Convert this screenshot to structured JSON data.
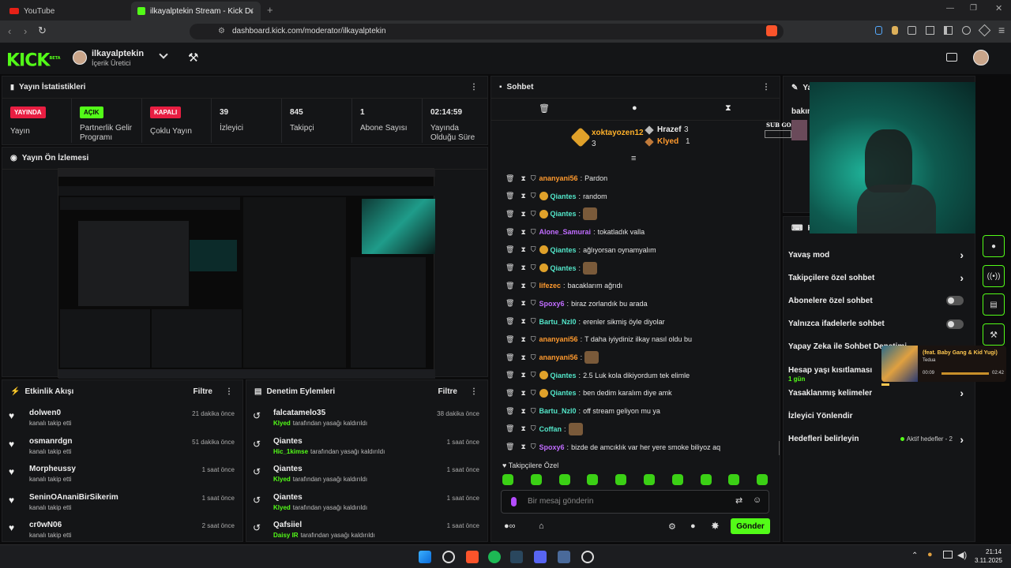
{
  "browser": {
    "tabs": [
      {
        "title": "YouTube"
      },
      {
        "title": "ilkayalptekin Stream - Kick Dashb"
      }
    ],
    "url": "dashboard.kick.com/moderator/ilkayalptekin"
  },
  "header": {
    "logo": "KICK",
    "logo_beta": "BETA",
    "user_name": "ilkayalptekin",
    "user_role": "İçerik Üretici"
  },
  "stats": {
    "title": "Yayın İstatistikleri",
    "items": [
      {
        "badge": "YAYINDA",
        "label": "Yayın"
      },
      {
        "badge": "AÇIK",
        "label": "Partnerlik Gelir Programı"
      },
      {
        "badge": "KAPALI",
        "label": "Çoklu Yayın"
      },
      {
        "value": "39",
        "label": "İzleyici"
      },
      {
        "value": "845",
        "label": "Takipçi"
      },
      {
        "value": "1",
        "label": "Abone Sayısı"
      },
      {
        "value": "02:14:59",
        "label": "Yayında Olduğu Süre"
      }
    ]
  },
  "preview": {
    "title": "Yayın Ön İzlemesi"
  },
  "activity": {
    "title": "Etkinlik Akışı",
    "filter": "Filtre",
    "items": [
      {
        "name": "dolwen0",
        "sub": "kanalı takip etti",
        "time": "21 dakika önce"
      },
      {
        "name": "osmanrdgn",
        "sub": "kanalı takip etti",
        "time": "51 dakika önce"
      },
      {
        "name": "Morpheussy",
        "sub": "kanalı takip etti",
        "time": "1 saat önce"
      },
      {
        "name": "SeninOAnaniBirSikerim",
        "sub": "kanalı takip etti",
        "time": "1 saat önce"
      },
      {
        "name": "cr0wN06",
        "sub": "kanalı takip etti",
        "time": "2 saat önce"
      }
    ]
  },
  "moderation": {
    "title": "Denetim Eylemleri",
    "filter": "Filtre",
    "items": [
      {
        "name": "falcatamelo35",
        "actor": "Klyed",
        "action": "tarafından yasağı kaldırıldı",
        "time": "38 dakika önce"
      },
      {
        "name": "Qiantes",
        "actor": "Hic_1kimse",
        "action": "tarafından yasağı kaldırıldı",
        "time": "1 saat önce"
      },
      {
        "name": "Qiantes",
        "actor": "Klyed",
        "action": "tarafından yasağı kaldırıldı",
        "time": "1 saat önce"
      },
      {
        "name": "Qiantes",
        "actor": "Klyed",
        "action": "tarafından yasağı kaldırıldı",
        "time": "1 saat önce"
      },
      {
        "name": "Qafsiiel",
        "actor": "Daisy IR",
        "action": "tarafından yasağı kaldırıldı",
        "time": "1 saat önce"
      }
    ]
  },
  "chat": {
    "title": "Sohbet",
    "top": [
      {
        "name": "xoktayozen12",
        "count": "3"
      },
      {
        "name": "Hrazef",
        "count": "3"
      },
      {
        "name": "Klyed",
        "count": "1"
      }
    ],
    "messages": [
      {
        "user": "ananyani56",
        "color": "#ff9a2e",
        "badge": false,
        "text": "Pardon"
      },
      {
        "user": "Qiantes",
        "color": "#53e6c9",
        "badge": true,
        "text": "random"
      },
      {
        "user": "Qiantes",
        "color": "#53e6c9",
        "badge": true,
        "text": "",
        "emote": true
      },
      {
        "user": "Alone_Samurai",
        "color": "#c06cff",
        "badge": false,
        "text": "tokatladık valla"
      },
      {
        "user": "Qiantes",
        "color": "#53e6c9",
        "badge": true,
        "text": "ağlıyorsan oynamyalım"
      },
      {
        "user": "Qiantes",
        "color": "#53e6c9",
        "badge": true,
        "text": "",
        "emote": true
      },
      {
        "user": "lifezec",
        "color": "#ff9a2e",
        "badge": false,
        "text": "bacaklarım ağrıdı"
      },
      {
        "user": "Spoxy6",
        "color": "#c06cff",
        "badge": false,
        "text": "biraz zorlandık bu arada"
      },
      {
        "user": "Bartu_Nzl0",
        "color": "#53e6c9",
        "badge": false,
        "text": "erenler sikmiş öyle diyolar"
      },
      {
        "user": "ananyani56",
        "color": "#ff9a2e",
        "badge": false,
        "text": "T daha iyiydiniz ilkay nasıl oldu bu"
      },
      {
        "user": "ananyani56",
        "color": "#ff9a2e",
        "badge": false,
        "text": "",
        "emote": true
      },
      {
        "user": "Qiantes",
        "color": "#53e6c9",
        "badge": true,
        "text": "2.5 Luk kola dikiyordum tek elimle"
      },
      {
        "user": "Qiantes",
        "color": "#53e6c9",
        "badge": true,
        "text": "ben dedim karalım diye amk"
      },
      {
        "user": "Bartu_Nzl0",
        "color": "#53e6c9",
        "badge": false,
        "text": "off stream geliyon mu ya"
      },
      {
        "user": "Coffan",
        "color": "#53e6c9",
        "badge": false,
        "text": "",
        "emote": true
      },
      {
        "user": "Spoxy6",
        "color": "#c06cff",
        "badge": false,
        "text": "bizde de amcıklık var her yere smoke biliyoz aq"
      }
    ],
    "emote_section": "Takipçilere Özel",
    "input_placeholder": "Bir mesaj gönderin",
    "send": "Gönder"
  },
  "settings": {
    "title_partial": "Yay",
    "card_partial": "Ka",
    "rows": [
      {
        "label": "Yavaş mod",
        "type": "arrow"
      },
      {
        "label": "Takipçilere özel sohbet",
        "type": "arrow"
      },
      {
        "label": "Abonelere özel sohbet",
        "type": "toggle"
      },
      {
        "label": "Yalnızca ifadelerle sohbet",
        "type": "toggle"
      },
      {
        "label": "Yapay Zeka ile Sohbet Denetimi",
        "type": "arrow"
      },
      {
        "label": "Hesap yaşı kısıtlaması",
        "sub": "1 gün",
        "type": "arrow"
      },
      {
        "label": "Yasaklanmış kelimeler",
        "type": "arrow"
      },
      {
        "label": "İzleyici Yönlendir",
        "type": "none"
      },
      {
        "label": "Hedefleri belirleyin",
        "extra": "Aktif hedefler - 2",
        "type": "arrow"
      }
    ],
    "bakim_partial": "bakın"
  },
  "overlay": {
    "sub_goal": "SUB GOAL"
  },
  "media": {
    "title": "(feat. Baby Gang & Kid Yugi)",
    "artist": "Tedua",
    "time_now": "00:09",
    "time_total": "02:42"
  },
  "taskbar": {
    "time": "21:14",
    "date": "3.11.2025"
  },
  "colors": {
    "accent": "#53fc18",
    "live_red": "#e91e42",
    "bg": "#0b0b0c",
    "panel": "#141517"
  }
}
